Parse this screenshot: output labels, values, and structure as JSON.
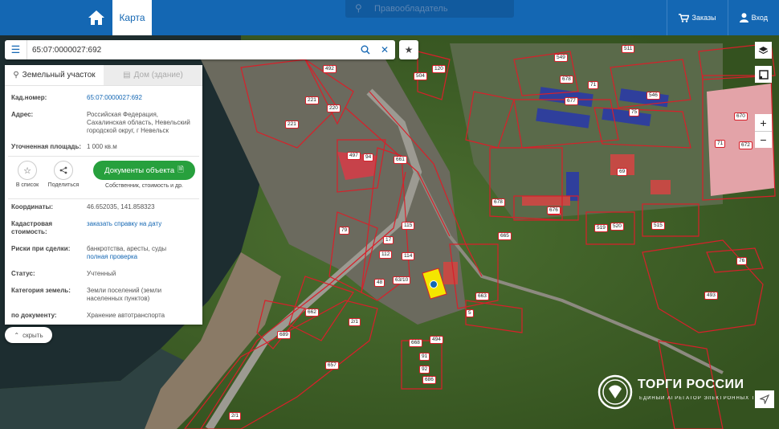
{
  "topbar": {
    "map_tab": "Карта",
    "ghost_search": "Правообладатель",
    "orders": "Заказы",
    "login": "Вход"
  },
  "search": {
    "value": "65:07:0000027:692"
  },
  "panel": {
    "tab_land": "Земельный участок",
    "tab_house": "Дом (здание)",
    "rows_top": [
      {
        "k": "Кад.номер:",
        "v": "65:07:0000027:692",
        "link": true
      },
      {
        "k": "Адрес:",
        "v": "Российская Федерация, Сахалинская область, Невельский городской округ, г Невельск",
        "link": false
      },
      {
        "k": "Уточненная площадь:",
        "v": "1 000 кв.м",
        "link": false
      }
    ],
    "actions": {
      "favorite": "В список",
      "share": "Поделиться",
      "documents": "Документы объекта",
      "documents_sub": "Собственник, стоимость и др."
    },
    "coords_k": "Координаты:",
    "coords_v": "46.652035, 141.858323",
    "cad_value_k": "Кадастровая стоимость:",
    "cad_value_v": "заказать справку на дату",
    "risks_k": "Риски при сделки:",
    "risks_v": "банкротства, аресты, суды",
    "risks_link": "полная проверка",
    "status_k": "Статус:",
    "status_v": "Учтенный",
    "category_k": "Категория земель:",
    "category_v": "Земли поселений (земли населенных пунктов)",
    "usage_k": "по документу:",
    "usage_v": "Хранение автотранспорта"
  },
  "hide_label": "скрыть",
  "map_labels": [
    "549",
    "511",
    "678",
    "71",
    "546",
    "677",
    "75",
    "221",
    "220",
    "221",
    "492",
    "504",
    "120",
    "497",
    "94",
    "661",
    "678",
    "675",
    "69",
    "665",
    "676",
    "670",
    "71",
    "672",
    "79",
    "17",
    "112",
    "114",
    "48",
    "63/10",
    "115",
    "520",
    "519",
    "515",
    "76",
    "493",
    "663",
    "662",
    "689",
    "5",
    "668",
    "494",
    "91",
    "92",
    "686",
    "657",
    "2/1",
    "2/1"
  ],
  "logo": {
    "title": "ТОРГИ РОССИИ",
    "subtitle": "ЕДИНЫЙ АГРЕГАТОР ЭЛЕКТРОННЫХ ТОРГОВ"
  },
  "colors": {
    "brand_blue": "#1467b3",
    "accent_green": "#27a03d",
    "parcel_red": "#d8202a",
    "selected_yellow": "#f4e600"
  }
}
